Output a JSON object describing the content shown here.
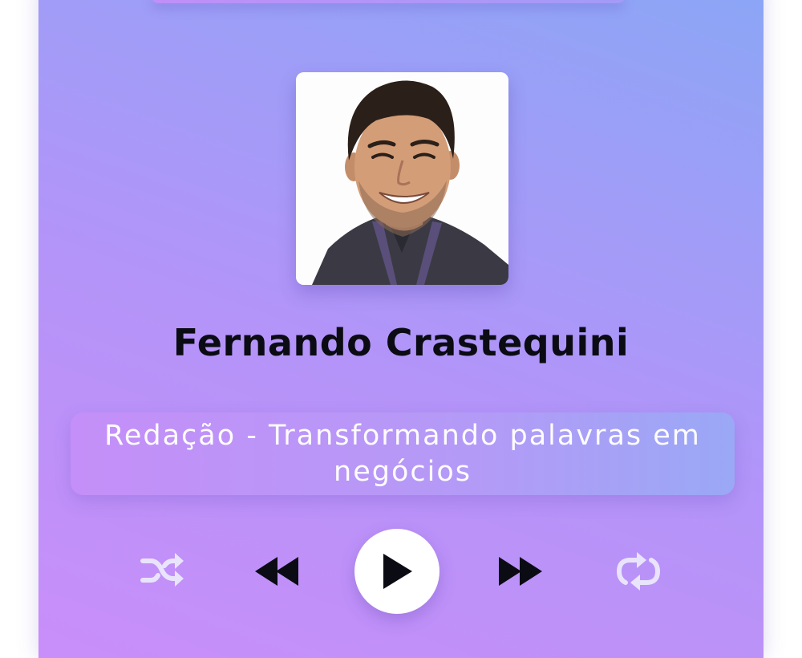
{
  "player": {
    "artist_name": "Fernando Crastequini",
    "episode_title": "Redação - Transformando palavras em negócios",
    "cover_image": "artist-portrait",
    "controls": {
      "shuffle_icon": "shuffle-icon",
      "previous_icon": "rewind-icon",
      "play_icon": "play-icon",
      "next_icon": "fast-forward-icon",
      "repeat_icon": "repeat-icon"
    }
  },
  "colors": {
    "gradient_start": "#c98ef9",
    "gradient_end": "#8ba6f6",
    "icon_light": "#e9e4fb",
    "icon_dark": "#0b0b14"
  }
}
